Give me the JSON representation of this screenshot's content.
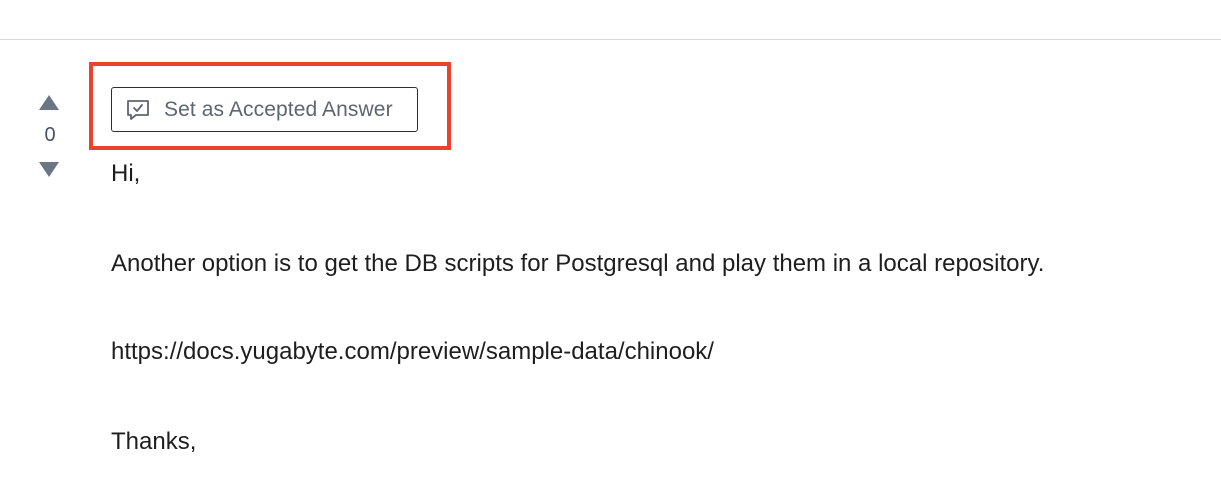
{
  "vote": {
    "count": "0",
    "up_icon": "triangle-up-icon",
    "down_icon": "triangle-down-icon"
  },
  "accept": {
    "label": "Set as Accepted Answer",
    "icon": "chat-check-icon"
  },
  "post": {
    "lines": [
      "Hi,",
      "Another option is to get the DB scripts for Postgresql and play them in a local repository.",
      "https://docs.yugabyte.com/preview/sample-data/chinook/",
      "Thanks,"
    ]
  },
  "colors": {
    "highlight": "#e8432d",
    "vote_arrow": "#6b7684",
    "button_text": "#5d6570"
  }
}
